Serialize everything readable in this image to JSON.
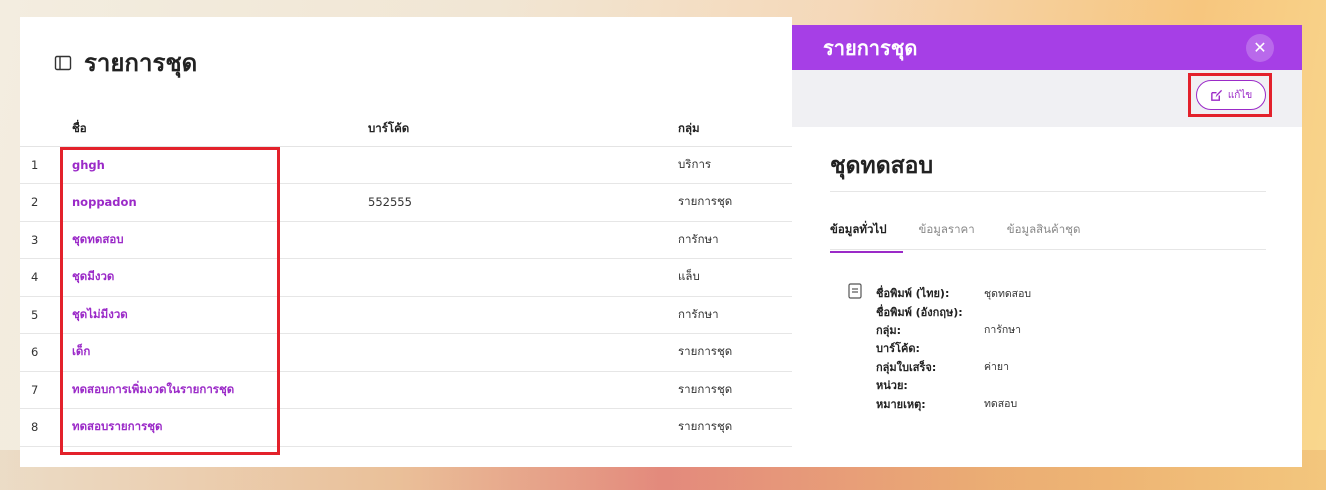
{
  "list": {
    "title": "รายการชุด",
    "columns": {
      "name": "ชื่อ",
      "barcode": "บาร์โค้ด",
      "group": "กลุ่ม"
    },
    "rows": [
      {
        "index": "1",
        "name": "ghgh",
        "barcode": "",
        "group": "บริการ"
      },
      {
        "index": "2",
        "name": "noppadon",
        "barcode": "552555",
        "group": "รายการชุด"
      },
      {
        "index": "3",
        "name": "ชุดทดสอบ",
        "barcode": "",
        "group": "การักษา"
      },
      {
        "index": "4",
        "name": "ชุดมีงวด",
        "barcode": "",
        "group": "แล็บ"
      },
      {
        "index": "5",
        "name": "ชุดไม่มีงวด",
        "barcode": "",
        "group": "การักษา"
      },
      {
        "index": "6",
        "name": "เด็ก",
        "barcode": "",
        "group": "รายการชุด"
      },
      {
        "index": "7",
        "name": "ทดสอบการเพิ่มงวดในรายการชุด",
        "barcode": "",
        "group": "รายการชุด"
      },
      {
        "index": "8",
        "name": "ทดสอบรายการชุด",
        "barcode": "",
        "group": "รายการชุด"
      }
    ]
  },
  "detail": {
    "title": "รายการชุด",
    "close_label": "✕",
    "edit_label": "แก้ไข",
    "item_name": "ชุดทดสอบ",
    "tabs": [
      {
        "label": "ข้อมูลทั่วไป",
        "active": true
      },
      {
        "label": "ข้อมูลราคา",
        "active": false
      },
      {
        "label": "ข้อมูลสินค้าชุด",
        "active": false
      }
    ],
    "fields": [
      {
        "label": "ชื่อพิมพ์ (ไทย):",
        "value": "ชุดทดสอบ"
      },
      {
        "label": "ชื่อพิมพ์ (อังกฤษ):",
        "value": ""
      },
      {
        "label": "กลุ่ม:",
        "value": "การักษา"
      },
      {
        "label": "บาร์โค้ด:",
        "value": ""
      },
      {
        "label": "กลุ่มใบเสร็จ:",
        "value": "ค่ายา"
      },
      {
        "label": "หน่วย:",
        "value": ""
      },
      {
        "label": "หมายเหตุ:",
        "value": "ทดสอบ"
      }
    ]
  },
  "colors": {
    "accent": "#a63fe6",
    "link": "#9b2ac8",
    "highlight": "#e3212b"
  },
  "icons": {
    "list_header": "book-icon",
    "close": "close-icon",
    "edit": "edit-icon",
    "fields": "document-icon"
  }
}
